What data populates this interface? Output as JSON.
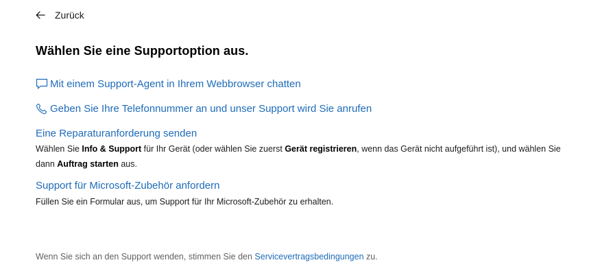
{
  "nav": {
    "back_label": "Zurück"
  },
  "title": "Wählen Sie eine Supportoption aus.",
  "options": {
    "chat_label": "Mit einem Support-Agent in Ihrem Webbrowser chatten",
    "phone_label": "Geben Sie Ihre Telefonnummer an und unser Support wird Sie anrufen"
  },
  "repair": {
    "link_label": "Eine Reparaturanforderung senden",
    "desc_part1": "Wählen Sie ",
    "desc_bold1": "Info & Support",
    "desc_part2": " für Ihr Gerät (oder wählen Sie zuerst ",
    "desc_bold2": "Gerät registrieren",
    "desc_part3": ", wenn das Gerät nicht aufgeführt ist), und wählen Sie dann ",
    "desc_bold3": "Auftrag starten",
    "desc_part4": " aus."
  },
  "accessories": {
    "link_label": "Support für Microsoft-Zubehör anfordern",
    "desc": "Füllen Sie ein Formular aus, um Support für Ihr Microsoft-Zubehör zu erhalten."
  },
  "footer": {
    "text_before": "Wenn Sie sich an den Support wenden, stimmen Sie den ",
    "link_label": "Servicevertragsbedingungen",
    "text_after": " zu."
  },
  "icons": {
    "back": "arrow-left-icon",
    "chat": "chat-bubble-icon",
    "phone": "phone-icon"
  },
  "colors": {
    "link": "#1e6bb8",
    "text": "#1b1b1b",
    "muted": "#616161",
    "background": "#ffffff"
  }
}
